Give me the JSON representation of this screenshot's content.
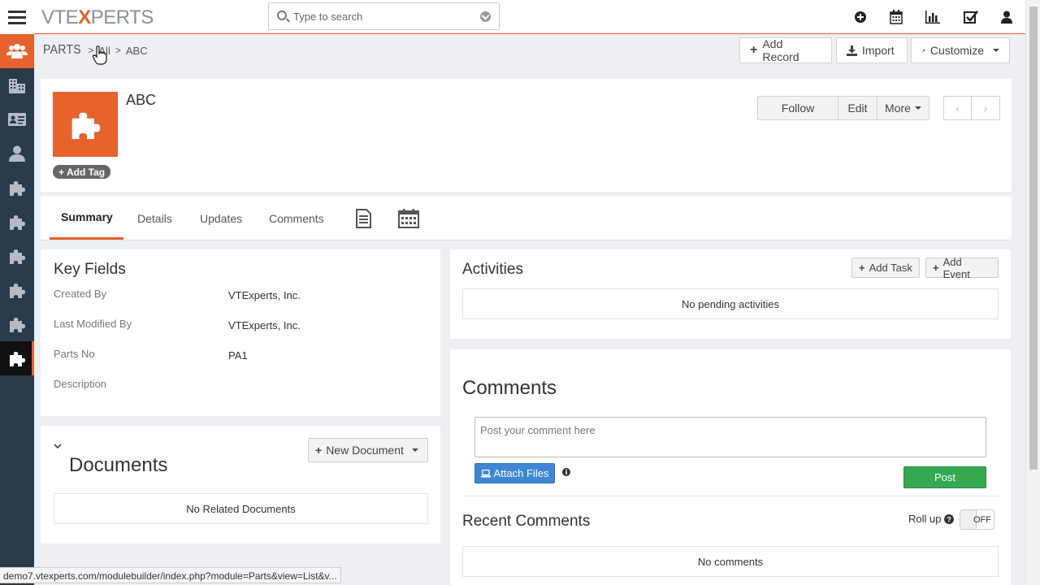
{
  "app": {
    "logo_main": "VTE",
    "logo_x": "X",
    "logo_rest": "PERTS"
  },
  "search": {
    "placeholder": "Type to search"
  },
  "top_icons": [
    "add-circle-icon",
    "calendar-icon",
    "chart-icon",
    "task-check-icon",
    "user-icon"
  ],
  "sidebar": {
    "items": [
      {
        "icon": "users-group-icon",
        "state": "active-orange"
      },
      {
        "icon": "building-icon"
      },
      {
        "icon": "contact-card-icon"
      },
      {
        "icon": "person-icon"
      },
      {
        "icon": "puzzle-icon"
      },
      {
        "icon": "puzzle-icon"
      },
      {
        "icon": "puzzle-icon"
      },
      {
        "icon": "puzzle-icon"
      },
      {
        "icon": "puzzle-icon"
      },
      {
        "icon": "puzzle-icon",
        "state": "active-black"
      }
    ]
  },
  "breadcrumb": {
    "module": "PARTS",
    "all": "All",
    "record": "ABC"
  },
  "header_actions": {
    "add_record": "Add Record",
    "import": "Import",
    "customize": "Customize"
  },
  "record": {
    "title": "ABC",
    "add_tag": "Add Tag",
    "follow": "Follow",
    "edit": "Edit",
    "more": "More"
  },
  "tabs": {
    "summary": "Summary",
    "details": "Details",
    "updates": "Updates",
    "comments": "Comments"
  },
  "key_fields": {
    "title": "Key Fields",
    "rows": [
      {
        "label": "Created By",
        "value": "VTExperts, Inc."
      },
      {
        "label": "Last Modified By",
        "value": "VTExperts, Inc."
      },
      {
        "label": "Parts No",
        "value": "PA1"
      },
      {
        "label": "Description",
        "value": ""
      }
    ]
  },
  "documents": {
    "title": "Documents",
    "new_document": "New Document",
    "empty": "No Related Documents"
  },
  "activities": {
    "title": "Activities",
    "add_task": "Add Task",
    "add_event": "Add Event",
    "empty": "No pending activities"
  },
  "comments": {
    "title": "Comments",
    "placeholder": "Post your comment here",
    "attach_files": "Attach Files",
    "post": "Post",
    "recent_title": "Recent Comments",
    "roll_up": "Roll up",
    "toggle": "OFF",
    "empty": "No comments"
  },
  "status_url": "demo7.vtexperts.com/modulebuilder/index.php?module=Parts&view=List&v..."
}
